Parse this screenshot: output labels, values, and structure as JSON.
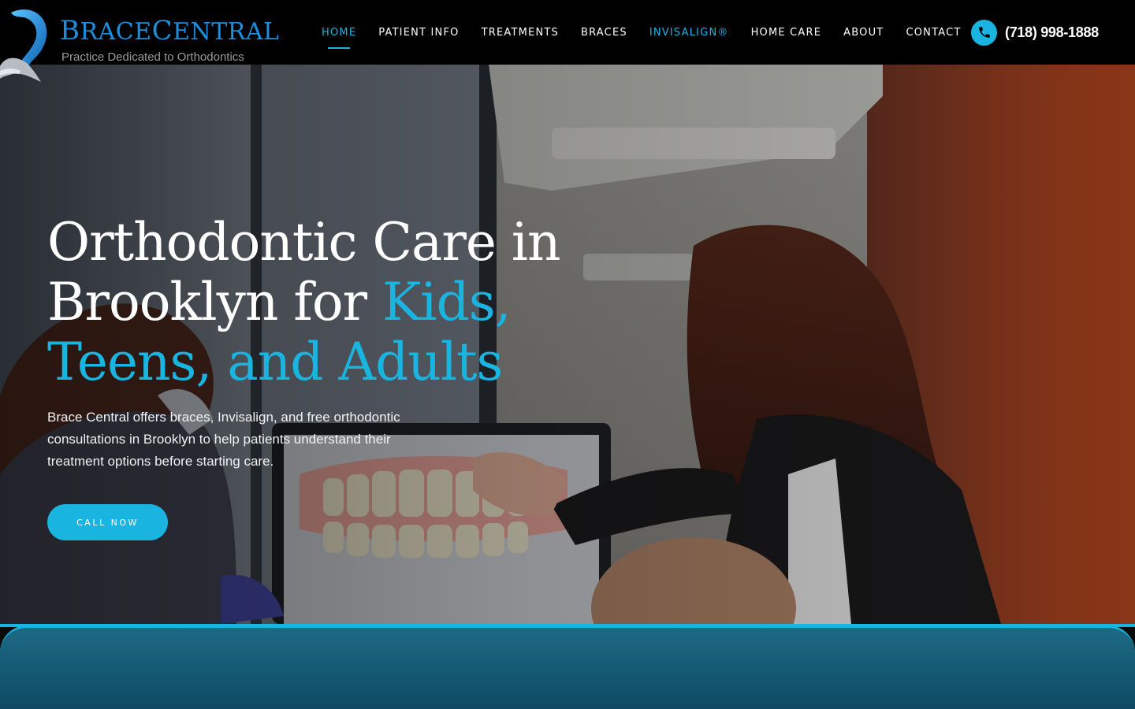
{
  "brand": {
    "name_first": "B",
    "name_rest1": "RACE",
    "name_mid": "C",
    "name_rest2": "ENTRAL",
    "tagline": "Practice Dedicated to Orthodontics",
    "logo_icon": "tooth-logo-icon"
  },
  "nav": {
    "items": [
      {
        "label": "HOME",
        "state": "active"
      },
      {
        "label": "PATIENT INFO",
        "state": ""
      },
      {
        "label": "TREATMENTS",
        "state": ""
      },
      {
        "label": "BRACES",
        "state": ""
      },
      {
        "label": "INVISALIGN®",
        "state": "accent"
      },
      {
        "label": "HOME CARE",
        "state": ""
      },
      {
        "label": "ABOUT",
        "state": ""
      },
      {
        "label": "CONTACT",
        "state": ""
      }
    ]
  },
  "phone": {
    "number": "(718) 998-1888",
    "icon": "phone-icon"
  },
  "hero": {
    "title_plain": "Orthodontic Care in Brooklyn for ",
    "title_highlight": "Kids, Teens, and Adults",
    "body": "Brace Central offers braces, Invisalign, and free orthodontic consultations in Brooklyn to help patients understand their treatment options before starting care.",
    "cta_label": "CALL NOW"
  },
  "colors": {
    "accent": "#1ab4e0",
    "header_bg": "#000000",
    "brand_blue": "#1b8fe0",
    "panel": "#0f4a62"
  }
}
